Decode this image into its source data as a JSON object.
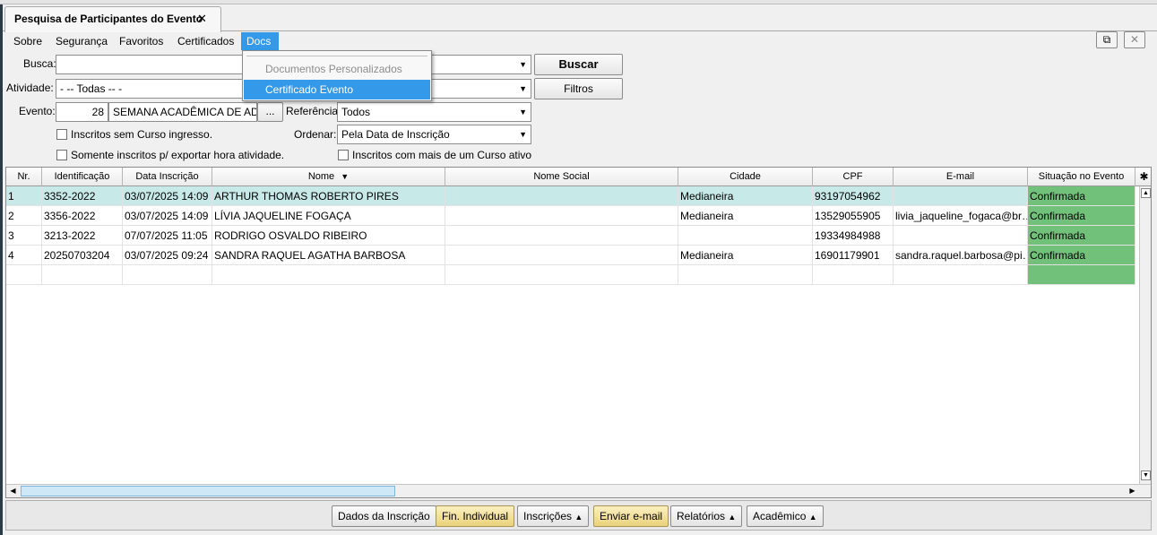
{
  "tab": {
    "title": "Pesquisa de Participantes do Evento",
    "close": "✕"
  },
  "menubar": [
    "Sobre",
    "Segurança",
    "Favoritos",
    "Certificados",
    "Docs"
  ],
  "topright": {
    "detach": "⧉",
    "close": "✕"
  },
  "docs_menu": {
    "item_disabled": "Documentos Personalizados",
    "item_selected": "Certificado Evento"
  },
  "form": {
    "busca_label": "Busca:",
    "busca_value": "",
    "buscar_button": "Buscar",
    "atividade_label": "Atividade:",
    "atividade_value": "- -- Todas -- -",
    "filtros_button": "Filtros",
    "evento_label": "Evento:",
    "evento_code": "28",
    "evento_name": "SEMANA ACADÊMICA DE ADM",
    "ellipsis_button": "...",
    "referencia_label": "Referência",
    "referencia_value": "Todos",
    "ordenar_label": "Ordenar:",
    "ordenar_value": "Pela Data de Inscrição",
    "chk_sem_curso": "Inscritos sem Curso ingresso.",
    "chk_exportar": "Somente inscritos p/ exportar hora atividade.",
    "chk_mais_curso": "Inscritos com mais de um Curso ativo"
  },
  "table": {
    "headers": [
      "Nr.",
      "Identificação",
      "Data Inscrição",
      "Nome",
      "Nome Social",
      "Cidade",
      "CPF",
      "E-mail",
      "Situação no Evento"
    ],
    "sort_indicator": "▼",
    "settings_icon": "✱",
    "rows": [
      [
        "1",
        "3352-2022",
        "03/07/2025 14:09",
        "ARTHUR THOMAS ROBERTO PIRES",
        "",
        "Medianeira",
        "93197054962",
        "",
        "Confirmada"
      ],
      [
        "2",
        "3356-2022",
        "03/07/2025 14:09",
        "LÍVIA JAQUELINE FOGAÇA",
        "",
        "Medianeira",
        "13529055905",
        "livia_jaqueline_fogaca@br…",
        "Confirmada"
      ],
      [
        "3",
        "3213-2022",
        "07/07/2025 11:05",
        "RODRIGO OSVALDO RIBEIRO",
        "",
        "",
        "19334984988",
        "",
        "Confirmada"
      ],
      [
        "4",
        "20250703204",
        "03/07/2025 09:24",
        "SANDRA RAQUEL AGATHA BARBOSA",
        "",
        "Medianeira",
        "16901179901",
        "sandra.raquel.barbosa@pi…",
        "Confirmada"
      ]
    ],
    "selected_row": 1,
    "colors": {
      "status": "#72c17a",
      "selected": "#c7e9e7"
    }
  },
  "footer": {
    "dados": "Dados da Inscrição",
    "fin": "Fin. Individual",
    "inscricoes": "Inscrições",
    "enviar": "Enviar e-mail",
    "relatorios": "Relatórios",
    "academico": "Acadêmico",
    "caret": "▲"
  }
}
